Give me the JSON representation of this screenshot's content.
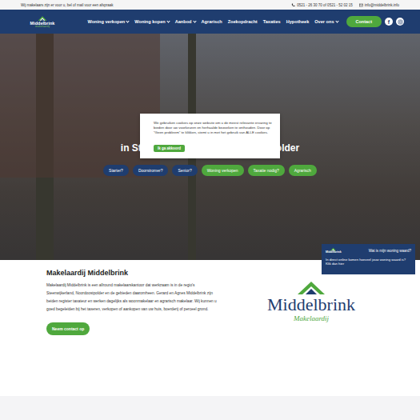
{
  "topbar": {
    "message": "Wij makelaars zijn er voor u, bel of mail voor een afspraak",
    "phone": "0521 - 26 30 70 of 0521 - 52 02 15",
    "email": "info@middelbrink.info"
  },
  "logo": {
    "name": "Middelbrink",
    "tagline": "makelaardij"
  },
  "nav": [
    {
      "label": "Woning verkopen",
      "dropdown": true
    },
    {
      "label": "Woning kopen",
      "dropdown": true
    },
    {
      "label": "Aanbod",
      "dropdown": true
    },
    {
      "label": "Agrarisch",
      "dropdown": false
    },
    {
      "label": "Zoekopdracht",
      "dropdown": false
    },
    {
      "label": "Taxaties",
      "dropdown": false
    },
    {
      "label": "Hypotheek",
      "dropdown": false
    },
    {
      "label": "Over ons",
      "dropdown": true
    }
  ],
  "contact_button": "Contact",
  "facebook": "f",
  "hero": {
    "heading": "in Steenwijkerland en Noordoostpolder",
    "buttons": [
      {
        "label": "Starter?",
        "color": "#1f3d6f"
      },
      {
        "label": "Doorstromer?",
        "color": "#1f3d6f"
      },
      {
        "label": "Senior?",
        "color": "#1f3d6f"
      },
      {
        "label": "Woning verkopen",
        "color": "#4fa83d"
      },
      {
        "label": "Taxatie nodig?",
        "color": "#4fa83d"
      },
      {
        "label": "Agrarisch",
        "color": "#4fa83d"
      }
    ]
  },
  "cookie": {
    "text": "We gebruiken cookies op onze website om u de meest relevante ervaring te bieden door uw voorkeuren en herhaalde bezoeken te onthouden. Door op \"Geen probleem\" te klikken, stemt u in met het gebruik van ALLE cookies.",
    "button": "Ik ga akkoord"
  },
  "widget": {
    "title": "Wat is mijn woning waard?",
    "text": "In direct online komen hoeveel jouw woning waard is? Klik dan hier"
  },
  "about": {
    "title": "Makelaardij Middelbrink",
    "text": "Makelaardij Middelbrink is een allround makelaarskantoor dat werkzaam is in de regio's Steenwijkerland, Noordoostpolder en de gebieden daaromheen. Gerard en Agnes Middelbrink zijn beiden register taxateur en werken dagelijks als woonmakelaar en agrarisch makelaar. Wij kunnen u goed begeleiden bij het taxeren, verkopen of aankopen van uw huis, boerderij of perceel grond.",
    "button": "Neem contact op"
  },
  "brand": {
    "name": "Middelbrink",
    "tagline": "Makelaardij"
  }
}
